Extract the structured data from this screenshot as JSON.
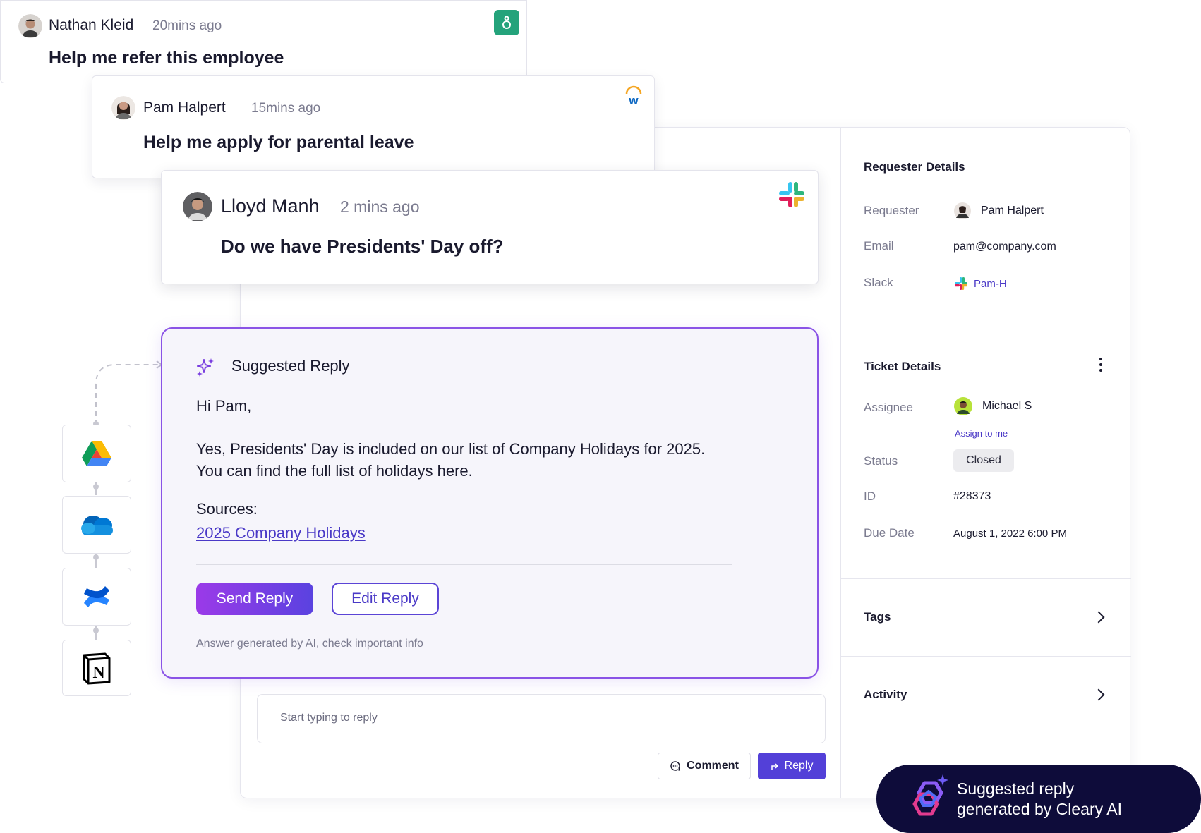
{
  "messages": [
    {
      "name": "Nathan Kleid",
      "time": "20mins ago",
      "question": "Help me refer this employee",
      "app_icon": "greenhouse-icon"
    },
    {
      "name": "Pam Halpert",
      "time": "15mins ago",
      "question": "Help me apply for parental leave",
      "app_icon": "workday-icon"
    },
    {
      "name": "Lloyd Manh",
      "time": "2 mins ago",
      "question": "Do we have Presidents' Day off?",
      "app_icon": "slack-icon"
    }
  ],
  "suggested_reply": {
    "title": "Suggested Reply",
    "greeting": "Hi Pam,",
    "body_line1": "Yes, Presidents' Day is included on our list of Company Holidays for 2025.",
    "body_line2": "You can find the full list of holidays here.",
    "sources_label": "Sources:",
    "source_link": "2025 Company Holidays",
    "send_label": "Send Reply",
    "edit_label": "Edit Reply",
    "disclaimer": "Answer generated by AI, check important info"
  },
  "sources_tools": [
    "google-drive-icon",
    "onedrive-icon",
    "confluence-icon",
    "notion-icon"
  ],
  "reply_box": {
    "placeholder": "Start typing to reply",
    "comment_label": "Comment",
    "reply_label": "Reply"
  },
  "requester_details": {
    "title": "Requester Details",
    "requester_label": "Requester",
    "requester_value": "Pam Halpert",
    "email_label": "Email",
    "email_value": "pam@company.com",
    "slack_label": "Slack",
    "slack_value": "Pam-H"
  },
  "ticket_details": {
    "title": "Ticket Details",
    "assignee_label": "Assignee",
    "assignee_value": "Michael S",
    "assign_to_me": "Assign to me",
    "status_label": "Status",
    "status_value": "Closed",
    "id_label": "ID",
    "id_value": "#28373",
    "due_label": "Due Date",
    "due_value": "August 1, 2022 6:00 PM"
  },
  "tags_title": "Tags",
  "activity_title": "Activity",
  "promo": {
    "line1": "Suggested reply",
    "line2": "generated by Cleary AI"
  },
  "colors": {
    "accent": "#5340d8",
    "suggest_border": "#8a53e6",
    "link": "#4a39c7",
    "promo_bg": "#0e0c3a"
  }
}
